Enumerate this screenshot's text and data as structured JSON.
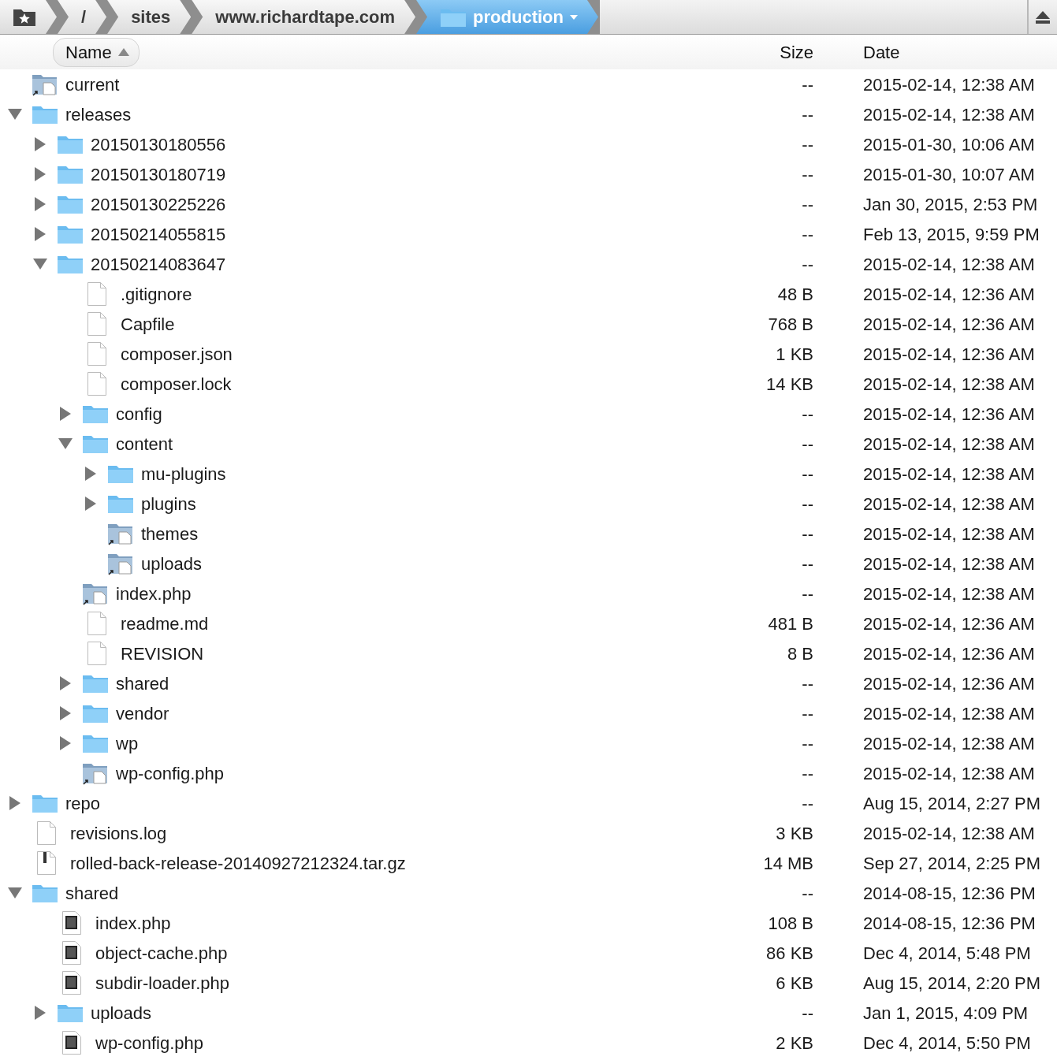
{
  "breadcrumbs": [
    {
      "kind": "favorites",
      "selected": false
    },
    {
      "kind": "folder",
      "label": "/",
      "selected": false
    },
    {
      "kind": "folder",
      "label": "sites",
      "selected": false
    },
    {
      "kind": "folder",
      "label": "www.richardtape.com",
      "selected": false
    },
    {
      "kind": "current",
      "label": "production",
      "selected": true
    }
  ],
  "columns": [
    {
      "label": "Name",
      "sorted": true
    },
    {
      "label": "Size",
      "sorted": false
    },
    {
      "label": "Date",
      "sorted": false
    }
  ],
  "files": [
    {
      "name": "current",
      "kind": "alias",
      "size": "--",
      "date": "2015-02-14, 12:38 AM"
    },
    {
      "name": "releases",
      "kind": "folder",
      "size": "--",
      "date": "2015-02-14, 12:38 AM",
      "expanded": true,
      "children": [
        {
          "name": "20150130180556",
          "kind": "folder",
          "size": "--",
          "date": "2015-01-30, 10:06 AM",
          "expanded": false
        },
        {
          "name": "20150130180719",
          "kind": "folder",
          "size": "--",
          "date": "2015-01-30, 10:07 AM",
          "expanded": false
        },
        {
          "name": "20150130225226",
          "kind": "folder",
          "size": "--",
          "date": "Jan 30, 2015, 2:53 PM",
          "expanded": false
        },
        {
          "name": "20150214055815",
          "kind": "folder",
          "size": "--",
          "date": "Feb 13, 2015, 9:59 PM",
          "expanded": false
        },
        {
          "name": "20150214083647",
          "kind": "folder",
          "size": "--",
          "date": "2015-02-14, 12:38 AM",
          "expanded": true,
          "children": [
            {
              "name": ".gitignore",
              "kind": "file",
              "size": "48 B",
              "date": "2015-02-14, 12:36 AM"
            },
            {
              "name": "Capfile",
              "kind": "file",
              "size": "768 B",
              "date": "2015-02-14, 12:36 AM"
            },
            {
              "name": "composer.json",
              "kind": "file",
              "size": "1 KB",
              "date": "2015-02-14, 12:36 AM"
            },
            {
              "name": "composer.lock",
              "kind": "file",
              "size": "14 KB",
              "date": "2015-02-14, 12:38 AM"
            },
            {
              "name": "config",
              "kind": "folder",
              "size": "--",
              "date": "2015-02-14, 12:36 AM",
              "expanded": false
            },
            {
              "name": "content",
              "kind": "folder",
              "size": "--",
              "date": "2015-02-14, 12:38 AM",
              "expanded": true,
              "children": [
                {
                  "name": "mu-plugins",
                  "kind": "folder",
                  "size": "--",
                  "date": "2015-02-14, 12:38 AM",
                  "expanded": false
                },
                {
                  "name": "plugins",
                  "kind": "folder",
                  "size": "--",
                  "date": "2015-02-14, 12:38 AM",
                  "expanded": false
                },
                {
                  "name": "themes",
                  "kind": "alias",
                  "size": "--",
                  "date": "2015-02-14, 12:38 AM"
                },
                {
                  "name": "uploads",
                  "kind": "alias",
                  "size": "--",
                  "date": "2015-02-14, 12:38 AM"
                }
              ]
            },
            {
              "name": "index.php",
              "kind": "alias",
              "size": "--",
              "date": "2015-02-14, 12:38 AM"
            },
            {
              "name": "readme.md",
              "kind": "file",
              "size": "481 B",
              "date": "2015-02-14, 12:36 AM"
            },
            {
              "name": "REVISION",
              "kind": "file",
              "size": "8 B",
              "date": "2015-02-14, 12:36 AM"
            },
            {
              "name": "shared",
              "kind": "folder",
              "size": "--",
              "date": "2015-02-14, 12:36 AM",
              "expanded": false
            },
            {
              "name": "vendor",
              "kind": "folder",
              "size": "--",
              "date": "2015-02-14, 12:38 AM",
              "expanded": false
            },
            {
              "name": "wp",
              "kind": "folder",
              "size": "--",
              "date": "2015-02-14, 12:38 AM",
              "expanded": false
            },
            {
              "name": "wp-config.php",
              "kind": "alias",
              "size": "--",
              "date": "2015-02-14, 12:38 AM"
            }
          ]
        }
      ]
    },
    {
      "name": "repo",
      "kind": "folder",
      "size": "--",
      "date": "Aug 15, 2014, 2:27 PM",
      "expanded": false
    },
    {
      "name": "revisions.log",
      "kind": "file",
      "size": "3 KB",
      "date": "2015-02-14, 12:38 AM"
    },
    {
      "name": "rolled-back-release-20140927212324.tar.gz",
      "kind": "archive",
      "size": "14 MB",
      "date": "Sep 27, 2014, 2:25 PM"
    },
    {
      "name": "shared",
      "kind": "folder",
      "size": "--",
      "date": "2014-08-15, 12:36 PM",
      "expanded": true,
      "children": [
        {
          "name": "index.php",
          "kind": "php",
          "size": "108 B",
          "date": "2014-08-15, 12:36 PM"
        },
        {
          "name": "object-cache.php",
          "kind": "php",
          "size": "86 KB",
          "date": "Dec 4, 2014, 5:48 PM"
        },
        {
          "name": "subdir-loader.php",
          "kind": "php",
          "size": "6 KB",
          "date": "Aug 15, 2014, 2:20 PM"
        },
        {
          "name": "uploads",
          "kind": "folder",
          "size": "--",
          "date": "Jan 1, 2015, 4:09 PM",
          "expanded": false
        },
        {
          "name": "wp-config.php",
          "kind": "php",
          "size": "2 KB",
          "date": "Dec 4, 2014, 5:50 PM"
        }
      ]
    }
  ]
}
